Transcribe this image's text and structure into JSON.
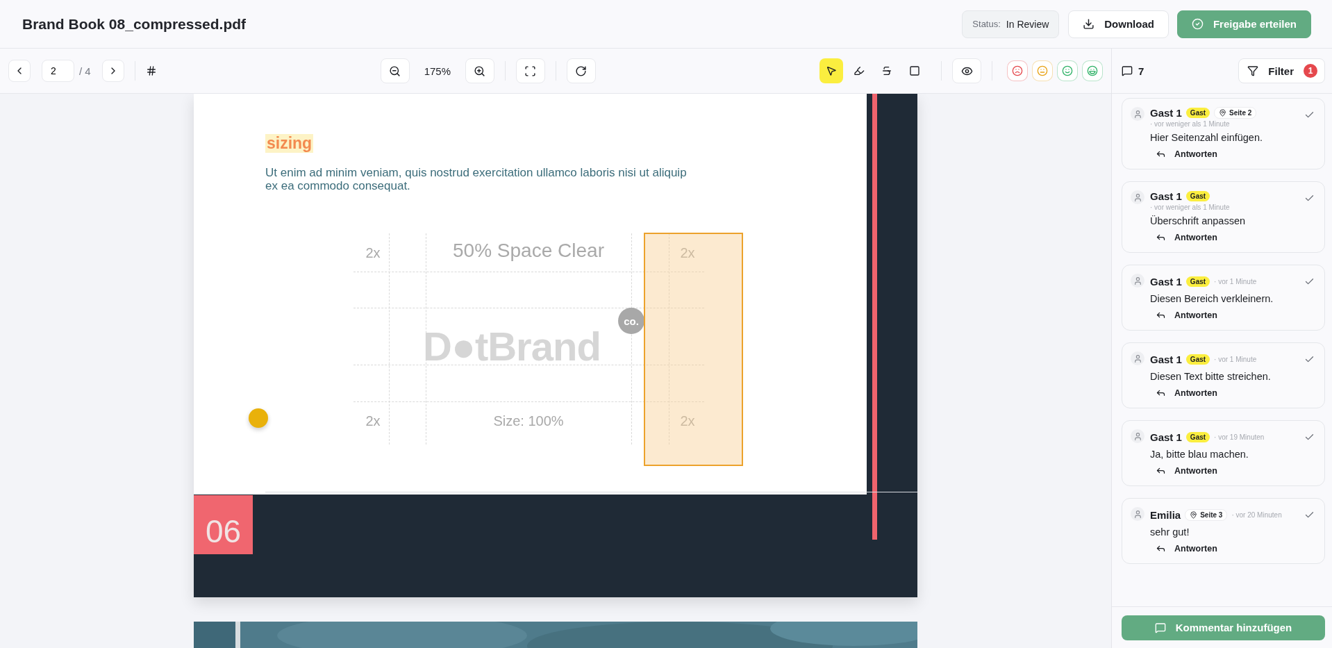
{
  "document": {
    "title": "Brand Book 08_compressed.pdf"
  },
  "header": {
    "status_label": "Status:",
    "status_value": "In Review",
    "buttons": [
      {
        "label": "Download",
        "kind": "secondary"
      },
      {
        "label": "Freigabe erteilen",
        "kind": "primary"
      }
    ]
  },
  "toolbar": {
    "page": "2",
    "page_total": "/ 4",
    "zoom": "175%",
    "tools": [
      {
        "kind": "select",
        "selected": true
      },
      {
        "kind": "highlight",
        "selected": false
      },
      {
        "kind": "strike",
        "selected": false
      },
      {
        "kind": "rectangle",
        "selected": false
      }
    ],
    "reactions": [
      {
        "kind": "frown",
        "color": "#e5484d"
      },
      {
        "kind": "meh",
        "color": "#e8a317"
      },
      {
        "kind": "smile",
        "color": "#2fb267"
      },
      {
        "kind": "laugh",
        "color": "#2fb267"
      }
    ]
  },
  "page_view": {
    "heading": "sizing",
    "paragraph": "Ut enim ad minim veniam, quis nostrud exercitation ullamco laboris nisi ut aliquip ex ea commodo consequat.",
    "diagram": {
      "top_left": "2x",
      "top_center": "50% Space Clear",
      "top_right": "2x",
      "bottom_left": "2x",
      "bottom_center": "Size: 100%",
      "bottom_right": "2x",
      "logo": "D●tBrand",
      "logo_badge": "co."
    },
    "page_number": "06",
    "annotations": [
      {
        "kind": "area",
        "color": "#eca22c"
      },
      {
        "kind": "pin",
        "color": "#e9b10b"
      }
    ]
  },
  "comments_panel": {
    "count": "7",
    "filter": {
      "label": "Filter",
      "badge": "1"
    },
    "comments": [
      {
        "author": "Gast 1",
        "role": "Gast",
        "page": "Seite 2",
        "time": "· vor weniger als 1 Minute",
        "text": "Hier Seitenzahl einfügen.",
        "reply": "Antworten"
      },
      {
        "author": "Gast 1",
        "role": "Gast",
        "time": "· vor weniger als 1 Minute",
        "text": "Überschrift anpassen",
        "reply": "Antworten"
      },
      {
        "author": "Gast 1",
        "role": "Gast",
        "time": "· vor 1 Minute",
        "text": "Diesen Bereich verkleinern.",
        "reply": "Antworten"
      },
      {
        "author": "Gast 1",
        "role": "Gast",
        "time": "· vor 1 Minute",
        "text": "Diesen Text bitte streichen.",
        "reply": "Antworten"
      },
      {
        "author": "Gast 1",
        "role": "Gast",
        "time": "· vor 19 Minuten",
        "text": "Ja, bitte blau machen.",
        "reply": "Antworten"
      },
      {
        "author": "Emilia",
        "page": "Seite 3",
        "time": "· vor 20 Minuten",
        "text": "sehr gut!",
        "reply": "Antworten"
      }
    ],
    "add_button": "Kommentar hinzufügen"
  }
}
